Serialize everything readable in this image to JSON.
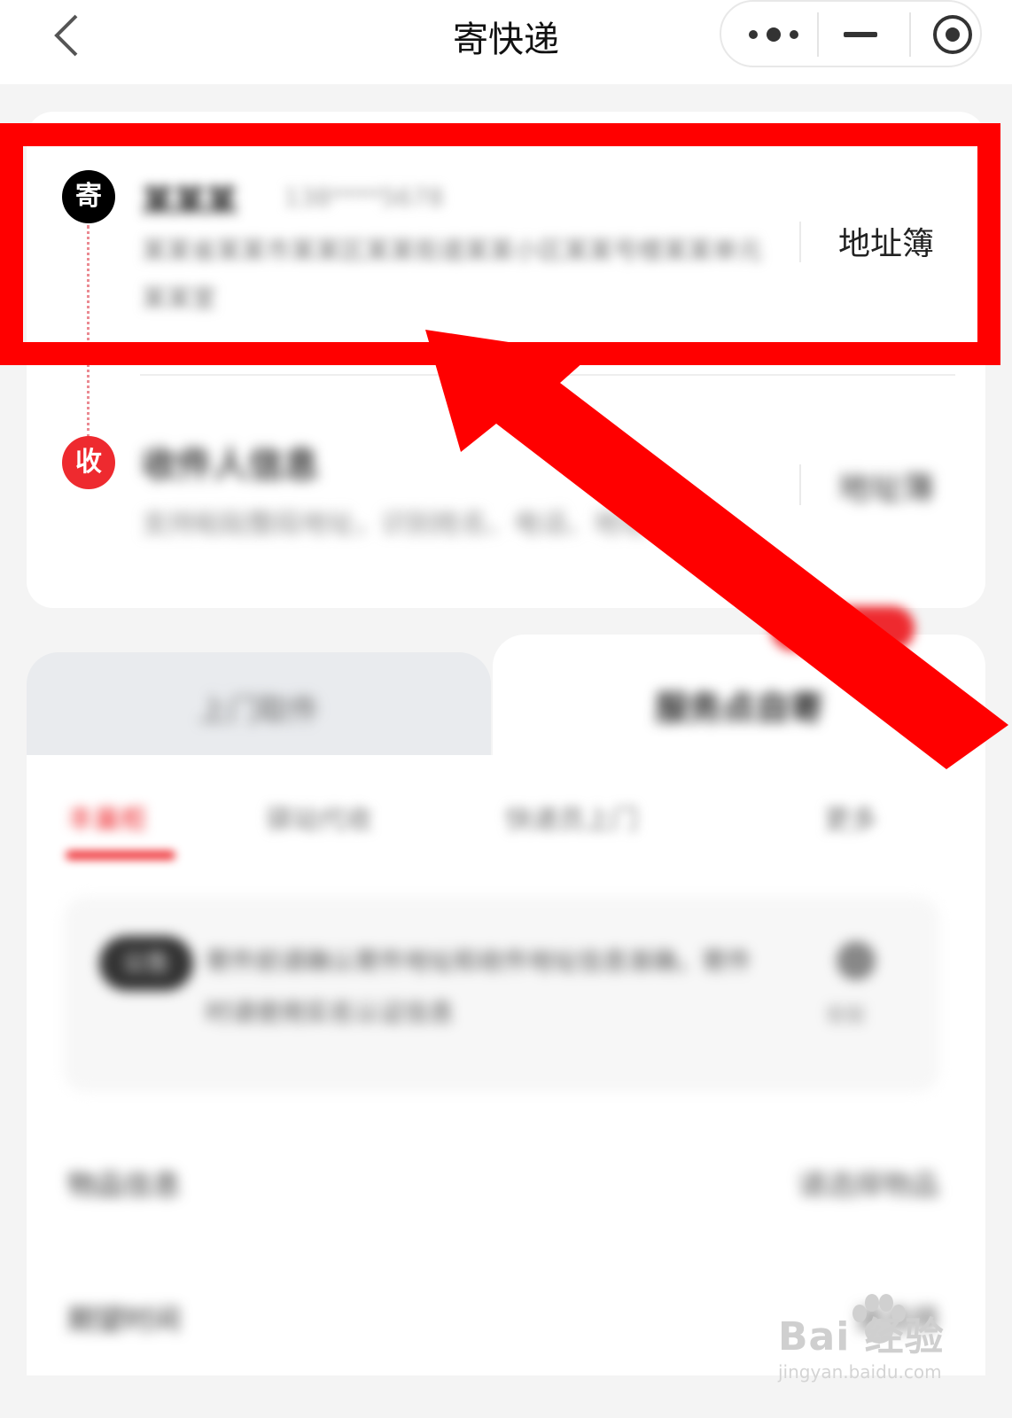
{
  "header": {
    "title": "寄快递"
  },
  "address": {
    "sender": {
      "badge": "寄",
      "name": "某某某",
      "phone": "138****5678",
      "address": "某某省某某市某某区某某街道某某小区某某号楼某某单元某某室",
      "book_label": "地址簿"
    },
    "recipient": {
      "badge": "收",
      "title": "收件人信息",
      "hint": "支持粘贴整段地址，识别姓名、电话、地址",
      "book_label": "地址簿"
    }
  },
  "tabs": {
    "left": "上门取件",
    "right": "服务点自寄"
  },
  "service": {
    "subtabs": [
      "丰巢柜",
      "驿站代收",
      "快递员上门",
      "更多"
    ],
    "notice": {
      "tag": "公告",
      "text": "寄件前请确认寄件地址和收件地址信息准确，寄件时请使用实名认证信息",
      "icon_label": "客服"
    },
    "rows": [
      {
        "label": "物品信息",
        "value": "请选择物品"
      },
      {
        "label": "期望时间",
        "value": "请选择"
      }
    ]
  },
  "watermark": {
    "logo": "Bai 经验",
    "url": "jingyan.baidu.com"
  },
  "colors": {
    "accent": "#ee2a2f",
    "annotation": "#ff0000"
  }
}
